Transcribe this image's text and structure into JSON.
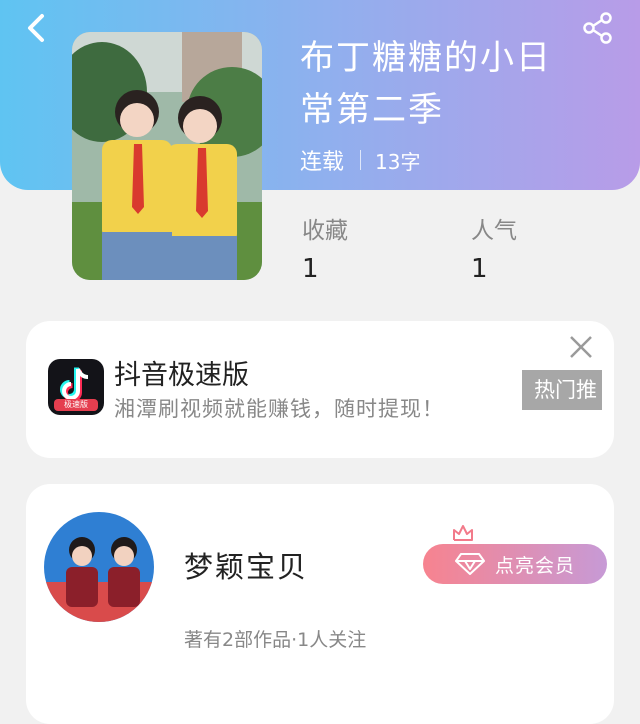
{
  "book": {
    "title_line1": "布丁糖糖的小日",
    "title_line2": "常第二季",
    "status": "连载",
    "word_count": "13字"
  },
  "stats": {
    "favorites_label": "收藏",
    "favorites_value": "1",
    "popularity_label": "人气",
    "popularity_value": "1"
  },
  "ad": {
    "logo_tag": "极速版",
    "title": "抖音极速版",
    "description": "湘潭刷视频就能赚钱，随时提现！",
    "hot_label": "热门推"
  },
  "author": {
    "name": "梦颖宝贝",
    "stats": "著有2部作品·1人关注",
    "vip_button": "点亮会员"
  },
  "colors": {
    "header_gradient_start": "#5fc4f2",
    "header_gradient_end": "#b89ce8",
    "vip_gradient_start": "#f7838f",
    "vip_gradient_end": "#c79ad6"
  },
  "icons": {
    "back": "chevron-left-icon",
    "share": "share-icon",
    "close": "close-icon",
    "diamond": "diamond-icon",
    "crown": "crown-icon"
  }
}
